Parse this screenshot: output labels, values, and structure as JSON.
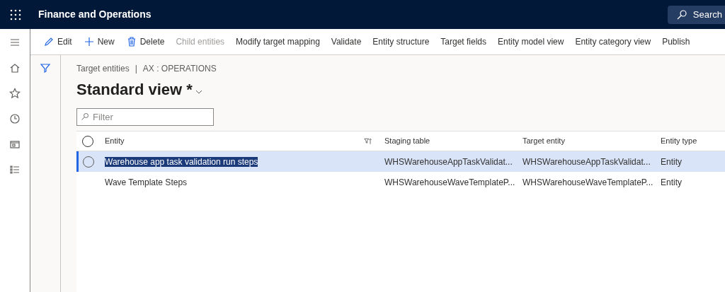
{
  "header": {
    "app_title": "Finance and Operations",
    "search_label": "Search"
  },
  "toolbar": [
    {
      "label": "Edit",
      "kind": "edit",
      "disabled": false
    },
    {
      "label": "New",
      "kind": "new",
      "disabled": false
    },
    {
      "label": "Delete",
      "kind": "delete",
      "disabled": false
    },
    {
      "label": "Child entities",
      "disabled": true
    },
    {
      "label": "Modify target mapping",
      "disabled": false
    },
    {
      "label": "Validate",
      "disabled": false
    },
    {
      "label": "Entity structure",
      "disabled": false
    },
    {
      "label": "Target fields",
      "disabled": false
    },
    {
      "label": "Entity model view",
      "disabled": false
    },
    {
      "label": "Entity category view",
      "disabled": false
    },
    {
      "label": "Publish",
      "disabled": false
    }
  ],
  "breadcrumb": {
    "page": "Target entities",
    "separator": "|",
    "company": "AX : OPERATIONS"
  },
  "view_title": "Standard view *",
  "filter": {
    "placeholder": "Filter"
  },
  "table": {
    "select_all_checked": false,
    "columns": [
      "Entity",
      "Staging table",
      "Target entity",
      "Entity type"
    ],
    "rows": [
      {
        "selected": true,
        "cells": [
          "Warehouse app task validation run steps",
          "WHSWarehouseAppTaskValidat...",
          "WHSWarehouseAppTaskValidat...",
          "Entity"
        ]
      },
      {
        "selected": false,
        "cells": [
          "Wave Template Steps",
          "WHSWarehouseWaveTemplateP...",
          "WHSWarehouseWaveTemplateP...",
          "Entity"
        ]
      }
    ]
  }
}
